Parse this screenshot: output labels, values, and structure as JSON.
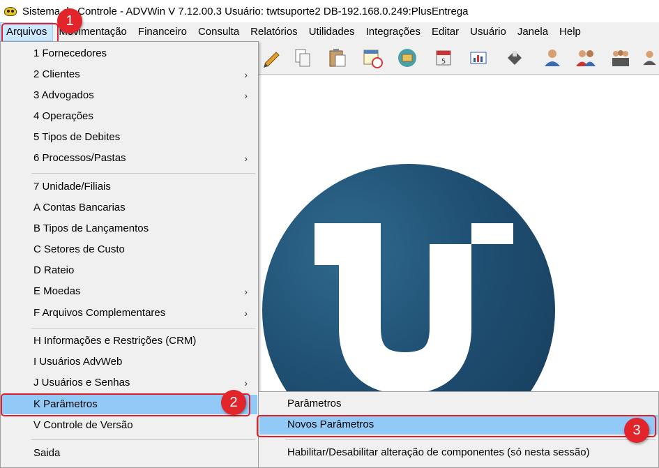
{
  "window": {
    "title": "Sistema de Controle - ADVWin  V 7.12.00.3  Usuário: twtsuporte2  DB-192.168.0.249:PlusEntrega"
  },
  "menubar": {
    "items": [
      "Arquivos",
      "Movimentação",
      "Financeiro",
      "Consulta",
      "Relatórios",
      "Utilidades",
      "Integrações",
      "Editar",
      "Usuário",
      "Janela",
      "Help"
    ]
  },
  "arquivos_menu": {
    "items": [
      {
        "label": "1 Fornecedores"
      },
      {
        "label": "2 Clientes"
      },
      {
        "label": "3 Advogados"
      },
      {
        "label": "4 Operações"
      },
      {
        "label": "5 Tipos de Debites"
      },
      {
        "label": "6 Processos/Pastas"
      },
      {
        "label": "7 Unidade/Filiais"
      },
      {
        "label": "A Contas Bancarias"
      },
      {
        "label": "B Tipos de Lançamentos"
      },
      {
        "label": "C Setores de Custo"
      },
      {
        "label": "D Rateio"
      },
      {
        "label": "E Moedas"
      },
      {
        "label": "F Arquivos Complementares"
      },
      {
        "label": "H Informações e Restrições (CRM)"
      },
      {
        "label": "I Usuários AdvWeb"
      },
      {
        "label": "J Usuários e Senhas"
      },
      {
        "label": "K Parâmetros"
      },
      {
        "label": "V Controle de Versão"
      },
      {
        "label": "Saida"
      }
    ],
    "arrow_glyph": "›"
  },
  "parametros_submenu": {
    "items": [
      {
        "label": "Parâmetros"
      },
      {
        "label": "Novos Parâmetros"
      },
      {
        "label": "Habilitar/Desabilitar alteração de componentes (só nesta sessão)"
      }
    ]
  },
  "callouts": [
    "1",
    "2",
    "3"
  ],
  "toolbar": {
    "icons": [
      "pencil-icon",
      "copy-icon",
      "paste-icon",
      "calendar-clock-icon",
      "folder-disc-icon",
      "calendar-icon",
      "chart-icon",
      "tag-icon",
      "user-icon",
      "users-icon",
      "group-icon",
      "user-partial-icon"
    ]
  },
  "colors": {
    "highlight": "#91c9f7",
    "callout": "#e2252b",
    "logo": "#1f4f72"
  }
}
